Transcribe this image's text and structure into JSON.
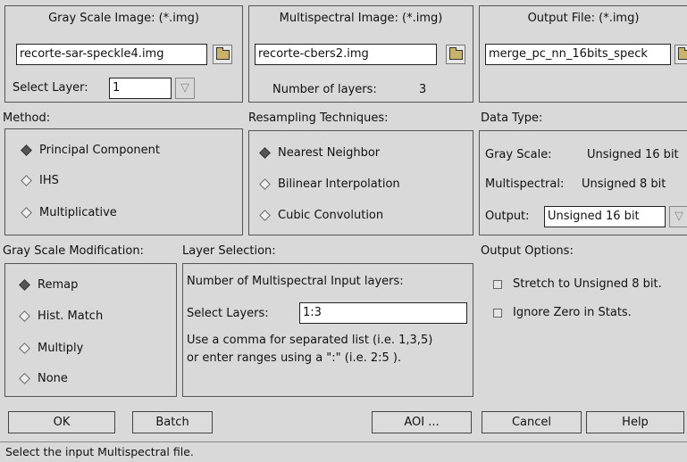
{
  "gray_scale": {
    "title": "Gray Scale Image: (*.img)",
    "file_value": "recorte-sar-speckle4.img",
    "select_layer_label": "Select Layer:",
    "select_layer_value": "1"
  },
  "multispectral": {
    "title": "Multispectral Image: (*.img)",
    "file_value": "recorte-cbers2.img",
    "num_layers_label": "Number of layers:",
    "num_layers_value": "3"
  },
  "output_file": {
    "title": "Output File: (*.img)",
    "file_value": "merge_pc_nn_16bits_speck"
  },
  "method": {
    "title": "Method:",
    "options": [
      "Principal Component",
      "IHS",
      "Multiplicative"
    ],
    "selected": "Principal Component"
  },
  "resampling": {
    "title": "Resampling Techniques:",
    "options": [
      "Nearest Neighbor",
      "Bilinear Interpolation",
      "Cubic Convolution"
    ],
    "selected": "Nearest Neighbor"
  },
  "data_type": {
    "title": "Data Type:",
    "gray_label": "Gray Scale:",
    "gray_value": "Unsigned 16 bit",
    "multi_label": "Multispectral:",
    "multi_value": "Unsigned 8 bit",
    "output_label": "Output:",
    "output_value": "Unsigned 16 bit"
  },
  "gray_mod": {
    "title": "Gray Scale Modification:",
    "options": [
      "Remap",
      "Hist. Match",
      "Multiply",
      "None"
    ],
    "selected": "Remap"
  },
  "layer_selection": {
    "title": "Layer Selection:",
    "num_input_label": "Number of Multispectral Input layers:",
    "select_layers_label": "Select Layers:",
    "select_layers_value": "1:3",
    "hint_line1": "Use a comma for separated list (i.e. 1,3,5)",
    "hint_line2": "or enter ranges using a \":\" (i.e. 2:5 )."
  },
  "output_options": {
    "title": "Output Options:",
    "stretch_label": "Stretch to Unsigned 8 bit.",
    "ignore_zero_label": "Ignore Zero in Stats."
  },
  "buttons": {
    "ok": "OK",
    "batch": "Batch",
    "aoi": "AOI ...",
    "cancel": "Cancel",
    "help": "Help"
  },
  "status_text": "Select the input Multispectral file.",
  "icons": {
    "file_browse": "folder-icon",
    "dropdown": "chevron-down-icon",
    "radio": "diamond-radio-icon",
    "checkbox": "checkbox-icon"
  }
}
